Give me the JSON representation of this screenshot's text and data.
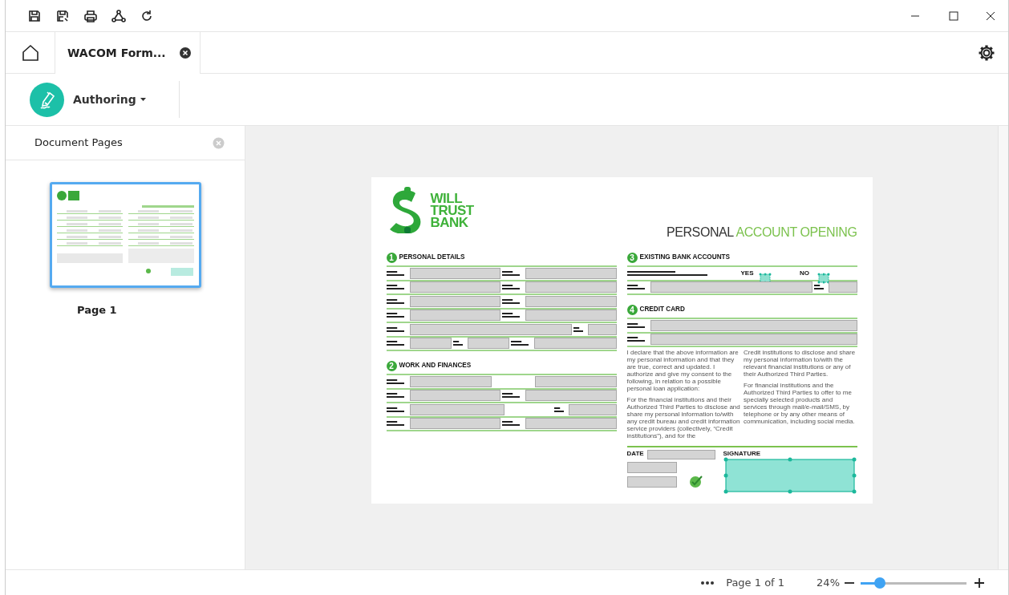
{
  "tabs": [
    {
      "label": "WACOM Form...",
      "selected": true
    }
  ],
  "mode_menu": {
    "label": "Authoring"
  },
  "sidebar": {
    "title": "Document Pages",
    "pages": [
      {
        "label": "Page 1",
        "selected": true
      }
    ]
  },
  "document": {
    "logo_text": "WILL TRUST BANK",
    "title_parts": [
      {
        "text": "PERSONAL",
        "color": "#333333"
      },
      {
        "text": "ACCOUNT OPENING",
        "color": "#7cc24e"
      }
    ],
    "columns": [
      {
        "sections": [
          {
            "number": "1",
            "title": "PERSONAL DETAILS",
            "rows": [
              [
                {
                  "kind": "label"
                },
                {
                  "kind": "field"
                },
                {
                  "kind": "label"
                },
                {
                  "kind": "field"
                }
              ],
              [
                {
                  "kind": "label"
                },
                {
                  "kind": "field"
                },
                {
                  "kind": "label"
                },
                {
                  "kind": "field"
                }
              ],
              [
                {
                  "kind": "label"
                },
                {
                  "kind": "field"
                },
                {
                  "kind": "label"
                },
                {
                  "kind": "field"
                }
              ],
              [
                {
                  "kind": "label"
                },
                {
                  "kind": "field"
                },
                {
                  "kind": "label"
                },
                {
                  "kind": "field"
                }
              ],
              [
                {
                  "kind": "label"
                },
                {
                  "kind": "wide-field"
                },
                {
                  "kind": "short-label"
                },
                {
                  "kind": "short-field"
                }
              ],
              [
                {
                  "kind": "label"
                },
                {
                  "kind": "short-field"
                },
                {
                  "kind": "short-label"
                },
                {
                  "kind": "short-field"
                },
                {
                  "kind": "label"
                },
                {
                  "kind": "field"
                }
              ]
            ]
          },
          {
            "number": "2",
            "title": "WORK AND FINANCES",
            "rows": [
              [
                {
                  "kind": "label"
                },
                {
                  "kind": "field"
                },
                {
                  "kind": "gap"
                },
                {
                  "kind": "field"
                }
              ],
              [
                {
                  "kind": "label"
                },
                {
                  "kind": "field"
                },
                {
                  "kind": "label"
                },
                {
                  "kind": "field"
                }
              ],
              [
                {
                  "kind": "label"
                },
                {
                  "kind": "field"
                },
                {
                  "kind": "gap"
                },
                {
                  "kind": "short-label"
                },
                {
                  "kind": "short-field"
                }
              ],
              [
                {
                  "kind": "label"
                },
                {
                  "kind": "field"
                },
                {
                  "kind": "label"
                },
                {
                  "kind": "field"
                }
              ]
            ]
          }
        ]
      },
      {
        "sections": [
          {
            "number": "3",
            "title": "EXISTING BANK ACCOUNTS",
            "rows": [
              [
                {
                  "kind": "long-label"
                },
                {
                  "kind": "caption",
                  "text": "YES"
                },
                {
                  "kind": "toggle"
                },
                {
                  "kind": "gap"
                },
                {
                  "kind": "caption",
                  "text": "NO"
                },
                {
                  "kind": "toggle"
                },
                {
                  "kind": "gap"
                }
              ],
              [
                {
                  "kind": "label"
                },
                {
                  "kind": "wide-field"
                },
                {
                  "kind": "short-label"
                },
                {
                  "kind": "short-field"
                }
              ]
            ]
          },
          {
            "number": "4",
            "title": "CREDIT CARD",
            "rows": [
              [
                {
                  "kind": "label"
                },
                {
                  "kind": "wide-field"
                }
              ],
              [
                {
                  "kind": "label"
                },
                {
                  "kind": "wide-field"
                }
              ]
            ]
          }
        ]
      }
    ],
    "declaration": [
      [
        "I declare that the above information are my personal information and that they are true, correct and updated. I authorize and give my consent to the following, in relation to a possible personal loan application:",
        "For the financial institutions and their Authorized Third Parties to disclose and share my personal information to/with any credit bureau and credit information service providers (collectively, “Credit institutions”), and for the"
      ],
      [
        "Credit institutions to disclose and share my personal information to/with the relevant financial institutions or any of their Authorized Third Parties.",
        "For financial institutions and the Authorized Third Parties to offer to me specially selected products and services through mail/e-mail/SMS, by telephone or by any other means of communication, including social media."
      ]
    ],
    "date_label": "DATE",
    "signature_label": "SIGNATURE"
  },
  "status_bar": {
    "page": "Page 1 of 1",
    "zoom": "24%",
    "level": 0.18
  }
}
